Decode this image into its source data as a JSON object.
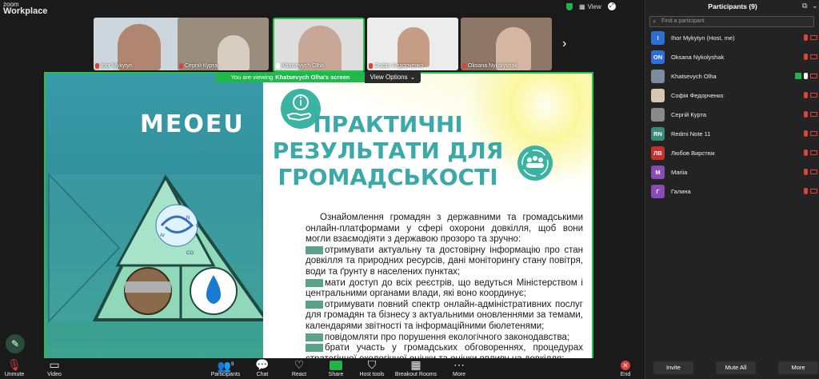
{
  "app": {
    "brand_line1": "zoom",
    "brand_line2": "Workplace",
    "view_label": "View"
  },
  "video_tiles": [
    {
      "name": "Ihor Mykytyn"
    },
    {
      "name": "Сергій Курта"
    },
    {
      "name": "Khatsevych Olha"
    },
    {
      "name": "Софія Федорченко"
    },
    {
      "name": "Oksana Nykolyshak"
    }
  ],
  "viewing_banner": {
    "prefix": "You are viewing",
    "presenter": "Khatsevych Olha's screen",
    "view_options": "View Options"
  },
  "slide": {
    "logo_text": "MEOEU",
    "title": "ПРАКТИЧНІ РЕЗУЛЬТАТИ ДЛЯ ГРОМАДСЬКОСТІ",
    "intro": "Ознайомлення громадян з державними та громадськими онлайн-платформами у сфері охорони довкілля, щоб вони могли взаємодіяти з державою прозоро та зручно:",
    "bullets": [
      "отримувати актуальну та достовірну інформацію про стан довкілля та природних ресурсів, дані моніторингу стану повітря, води та ґрунту в населених пунктах;",
      "мати доступ до всіх реєстрів, що ведуться Міністерством і центральними органами влади, які воно координує;",
      "отримувати повний спектр онлайн-адміністративних послуг для громадян та бізнесу з актуальними оновленнями за темами, календарями звітності та інформаційними бюлетенями;",
      "повідомляти про порушення екологічного законодавства;",
      "брати участь у громадських обговореннях, процедурах стратегічної екологічної оцінки та оцінки впливу на довкілля;"
    ],
    "cycle_labels": {
      "n2": "N",
      "o2": "O",
      "ar": "Ar",
      "co2": "CO"
    }
  },
  "toolbar": [
    {
      "label": "Unmute",
      "icon": "mic-off-icon"
    },
    {
      "label": "Video",
      "icon": "video-icon"
    },
    {
      "label": "Participants",
      "icon": "participants-icon",
      "count": "9"
    },
    {
      "label": "Chat",
      "icon": "chat-icon"
    },
    {
      "label": "React",
      "icon": "heart-icon"
    },
    {
      "label": "Share",
      "icon": "share-icon"
    },
    {
      "label": "Host tools",
      "icon": "shield-icon"
    },
    {
      "label": "Breakout Rooms",
      "icon": "grid-icon"
    },
    {
      "label": "More",
      "icon": "more-icon"
    },
    {
      "label": "End",
      "icon": "close-icon"
    }
  ],
  "participants_panel": {
    "title": "Participants (9)",
    "search_placeholder": "Find a participant",
    "participants": [
      {
        "name": "Ihor Mykytyn (Host, me)",
        "initials": "I",
        "color": "#2d6fd6"
      },
      {
        "name": "Oksana Nykolyshak",
        "initials": "ON",
        "color": "#2d6fd6"
      },
      {
        "name": "Khatsevych Olha",
        "initials": "",
        "color": "#7a8ca0"
      },
      {
        "name": "Софія Федорченко",
        "initials": "",
        "color": "#d9c6b0"
      },
      {
        "name": "Сергій Курта",
        "initials": "",
        "color": "#8a8a8a"
      },
      {
        "name": "Redmi Note 11",
        "initials": "RN",
        "color": "#3a8a7a"
      },
      {
        "name": "Любов Вирстюк",
        "initials": "ЛВ",
        "color": "#c9302c"
      },
      {
        "name": "Mariia",
        "initials": "M",
        "color": "#8a4ab8"
      },
      {
        "name": "Галина",
        "initials": "Г",
        "color": "#8a4ab8"
      }
    ],
    "invite": "Invite",
    "mute_all": "Mute All",
    "more": "More"
  }
}
